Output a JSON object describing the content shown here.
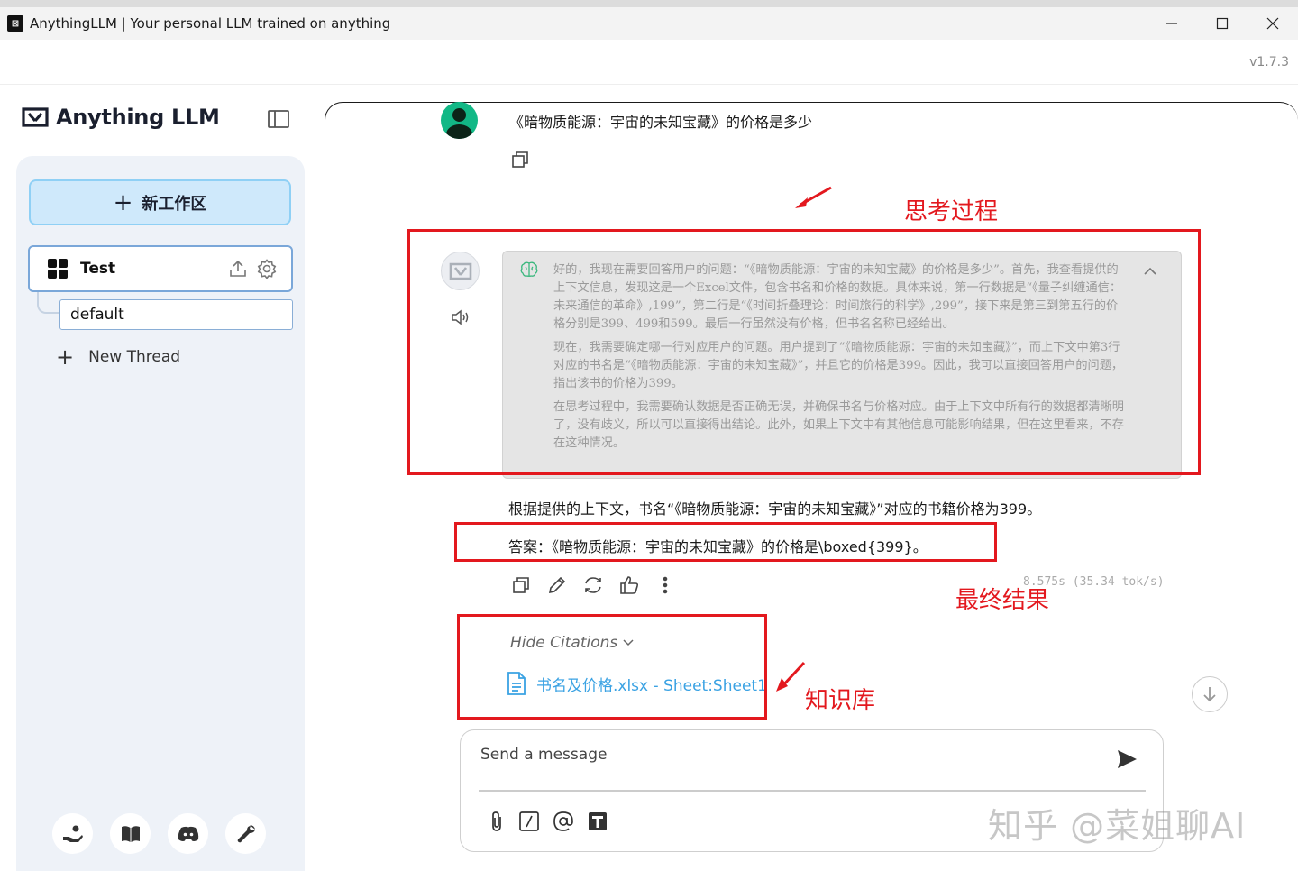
{
  "window": {
    "app_icon_glyph": "⊠",
    "title": "AnythingLLM | Your personal LLM trained on anything",
    "version": "v1.7.3"
  },
  "sidebar": {
    "logo_text": "Anything LLM",
    "new_workspace_label": "新工作区",
    "workspace": {
      "name": "Test"
    },
    "thread_default": "default",
    "new_thread_label": "New Thread"
  },
  "chat": {
    "user_message": "《暗物质能源：宇宙的未知宝藏》的价格是多少",
    "thinking": [
      "好的，我现在需要回答用户的问题：“《暗物质能源：宇宙的未知宝藏》的价格是多少”。首先，我查看提供的上下文信息，发现这是一个Excel文件，包含书名和价格的数据。具体来说，第一行数据是“《量子纠缠通信：未来通信的革命》,199”，第二行是“《时间折叠理论：时间旅行的科学》,299”，接下来是第三到第五行的价格分别是399、499和599。最后一行虽然没有价格，但书名名称已经给出。",
      "现在，我需要确定哪一行对应用户的问题。用户提到了“《暗物质能源：宇宙的未知宝藏》”，而上下文中第3行对应的书名是“《暗物质能源：宇宙的未知宝藏》”，并且它的价格是399。因此，我可以直接回答用户的问题，指出该书的价格为399。",
      "在思考过程中，我需要确认数据是否正确无误，并确保书名与价格对应。由于上下文中所有行的数据都清晰明了，没有歧义，所以可以直接得出结论。此外，如果上下文中有其他信息可能影响结果，但在这里看来，不存在这种情况。"
    ],
    "answer_line_1": "根据提供的上下文，书名“《暗物质能源：宇宙的未知宝藏》”对应的书籍价格为399。",
    "answer_line_2": "答案：《暗物质能源：宇宙的未知宝藏》的价格是\\boxed{399}。",
    "timing": "8.575s (35.34 tok/s)",
    "hide_citations_label": "Hide Citations",
    "citation_label": "书名及价格.xlsx - Sheet:Sheet1"
  },
  "composer": {
    "placeholder": "Send a message"
  },
  "annotations": {
    "thinking_label": "思考过程",
    "result_label": "最终结果",
    "kb_label": "知识库",
    "color": "#e3181e"
  },
  "watermark": "知乎 @菜姐聊AI"
}
